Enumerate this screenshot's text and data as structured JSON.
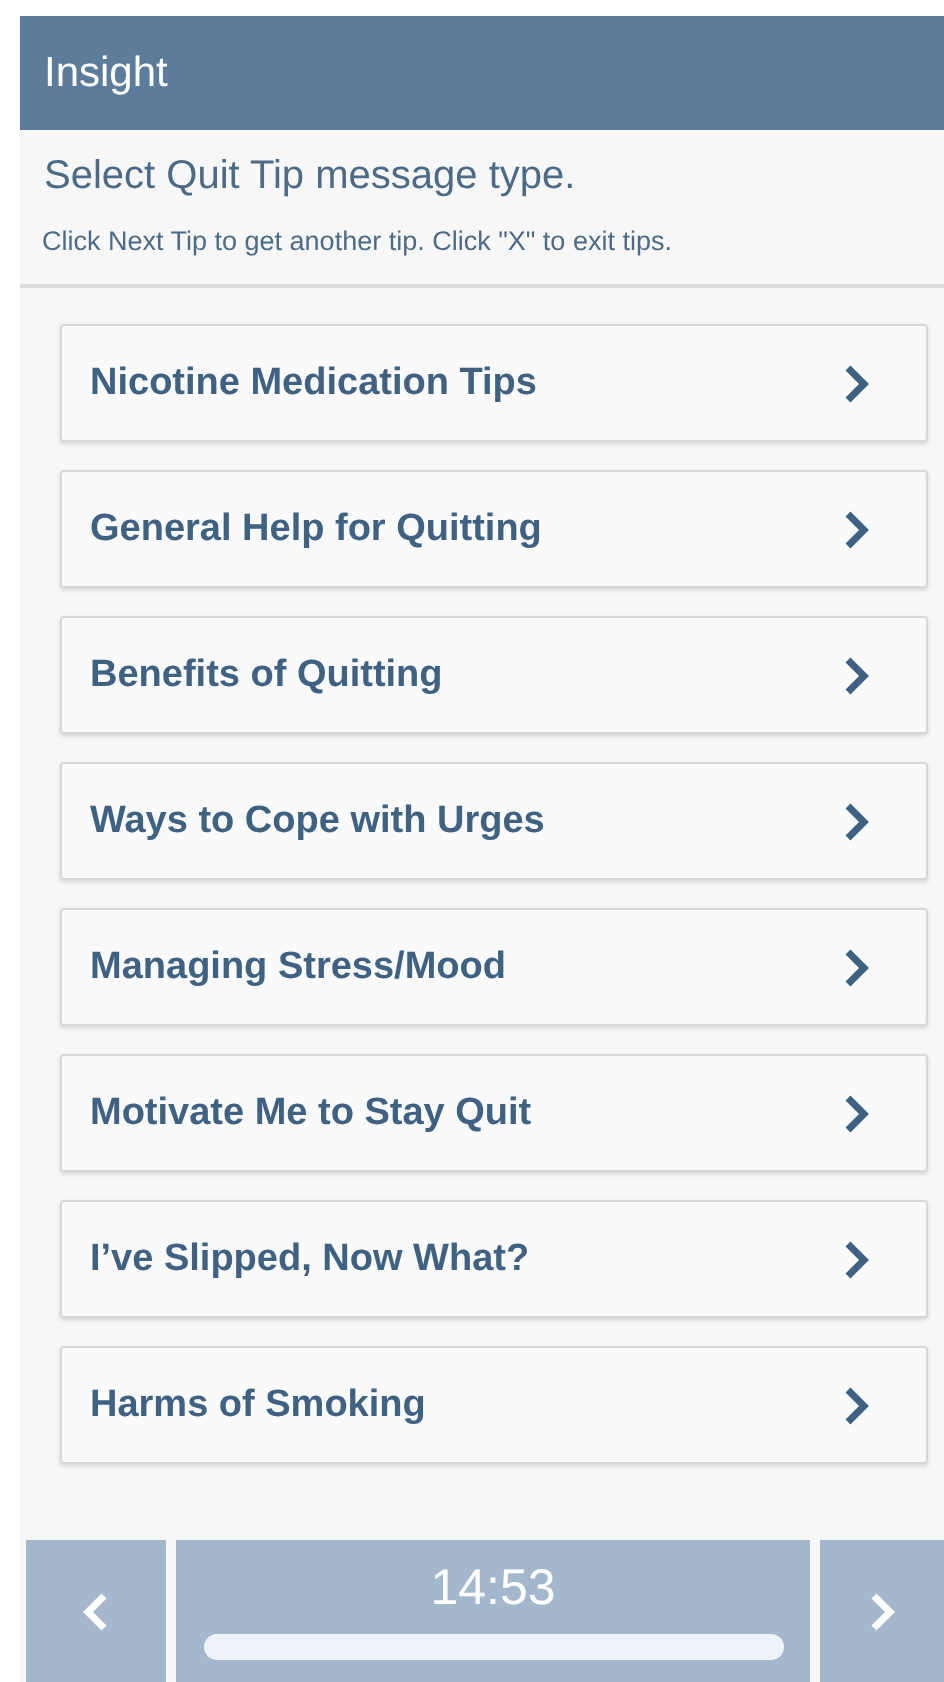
{
  "header": {
    "title": "Insight"
  },
  "prompt": "Select Quit Tip message type.",
  "hint": "Click Next Tip to get another tip. Click \"X\" to exit tips.",
  "options": [
    {
      "label": "Nicotine Medication Tips"
    },
    {
      "label": "General Help for Quitting"
    },
    {
      "label": "Benefits of Quitting"
    },
    {
      "label": "Ways to Cope with Urges"
    },
    {
      "label": "Managing Stress/Mood"
    },
    {
      "label": "Motivate Me to Stay Quit"
    },
    {
      "label": "I’ve Slipped, Now What?"
    },
    {
      "label": "Harms of Smoking"
    }
  ],
  "bottom_bar": {
    "time": "14:53"
  }
}
